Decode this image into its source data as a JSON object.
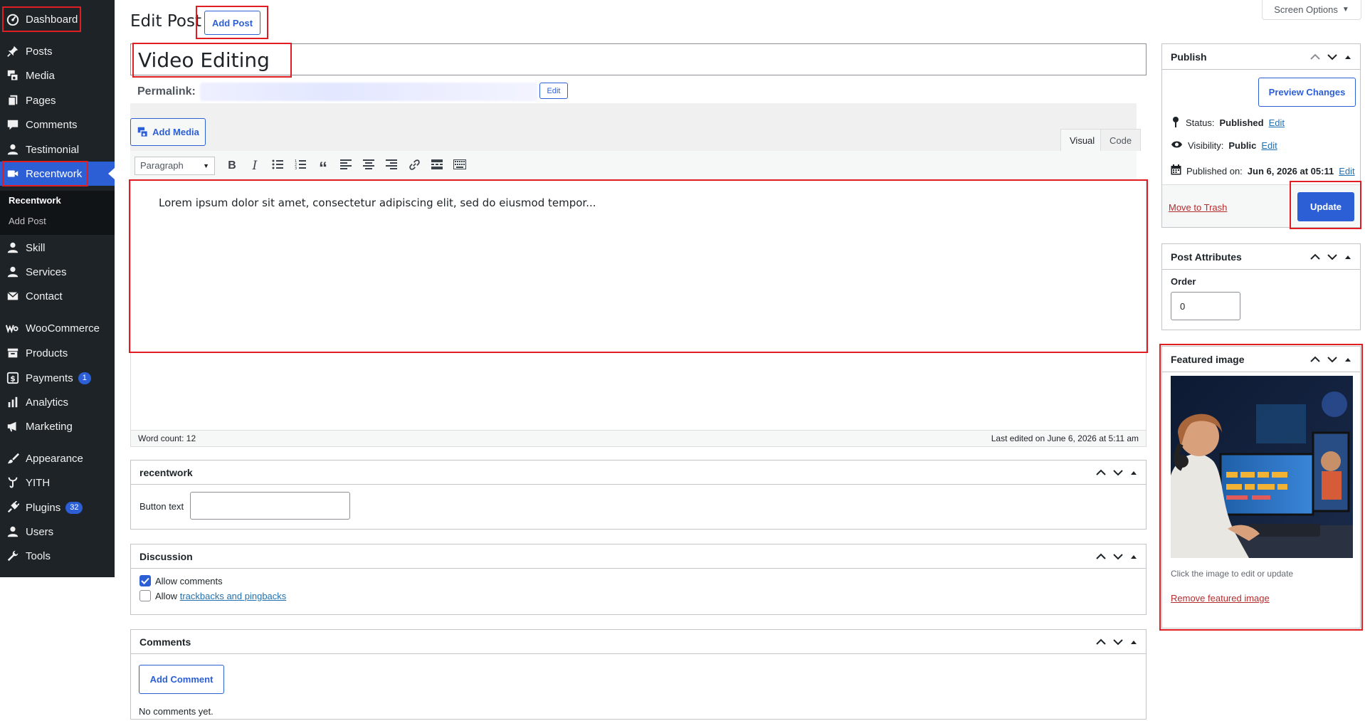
{
  "sidebar": {
    "items": [
      {
        "label": "Dashboard",
        "icon": "dashboard-icon"
      },
      {
        "label": "Posts",
        "icon": "pin-icon"
      },
      {
        "label": "Media",
        "icon": "media-icon"
      },
      {
        "label": "Pages",
        "icon": "pages-icon"
      },
      {
        "label": "Comments",
        "icon": "comment-icon"
      },
      {
        "label": "Testimonial",
        "icon": "user-icon"
      },
      {
        "label": "Recentwork",
        "icon": "video-icon"
      },
      {
        "label": "Skill",
        "icon": "user-icon"
      },
      {
        "label": "Services",
        "icon": "user-icon"
      },
      {
        "label": "Contact",
        "icon": "mail-icon"
      },
      {
        "label": "WooCommerce",
        "icon": "woo-icon"
      },
      {
        "label": "Products",
        "icon": "archive-icon"
      },
      {
        "label": "Payments",
        "icon": "dollar-icon",
        "badge": "1"
      },
      {
        "label": "Analytics",
        "icon": "bar-chart-icon"
      },
      {
        "label": "Marketing",
        "icon": "megaphone-icon"
      },
      {
        "label": "Appearance",
        "icon": "brush-icon"
      },
      {
        "label": "YITH",
        "icon": "yith-icon"
      },
      {
        "label": "Plugins",
        "icon": "plug-icon",
        "badge": "32"
      },
      {
        "label": "Users",
        "icon": "user-icon"
      },
      {
        "label": "Tools",
        "icon": "wrench-icon"
      }
    ],
    "submenu": {
      "current": "Recentwork",
      "add": "Add Post"
    }
  },
  "header": {
    "title": "Edit Post",
    "add_post": "Add Post",
    "screen_options": "Screen Options"
  },
  "post": {
    "title": "Video Editing",
    "permalink_label": "Permalink:",
    "permalink_edit": "Edit",
    "content": "Lorem ipsum dolor sit amet, consectetur adipiscing elit, sed do eiusmod tempor..."
  },
  "editor": {
    "add_media": "Add Media",
    "tab_visual": "Visual",
    "tab_code": "Code",
    "format": "Paragraph",
    "word_count": "Word count: 12",
    "last_edited": "Last edited on June 6, 2026 at 5:11 am"
  },
  "recentwork_box": {
    "title": "recentwork",
    "button_text_label": "Button text",
    "button_text_value": ""
  },
  "discussion": {
    "title": "Discussion",
    "allow_comments": "Allow comments",
    "allow_prefix": "Allow",
    "trackbacks_link": "trackbacks and pingbacks",
    "allow_comments_checked": true,
    "trackbacks_checked": false
  },
  "comments": {
    "title": "Comments",
    "add_comment": "Add Comment",
    "empty": "No comments yet."
  },
  "publish": {
    "title": "Publish",
    "preview": "Preview Changes",
    "status_label": "Status:",
    "status_value": "Published",
    "visibility_label": "Visibility:",
    "visibility_value": "Public",
    "published_label": "Published on:",
    "published_value": "Jun 6, 2026 at 05:11",
    "edit": "Edit",
    "trash": "Move to Trash",
    "update": "Update"
  },
  "attributes": {
    "title": "Post Attributes",
    "order_label": "Order",
    "order_value": "0"
  },
  "featured": {
    "title": "Featured image",
    "hint": "Click the image to edit or update",
    "remove": "Remove featured image"
  },
  "colors": {
    "accent": "#2c5fd6",
    "sidebar": "#1d2327",
    "highlight": "#e11d24"
  }
}
